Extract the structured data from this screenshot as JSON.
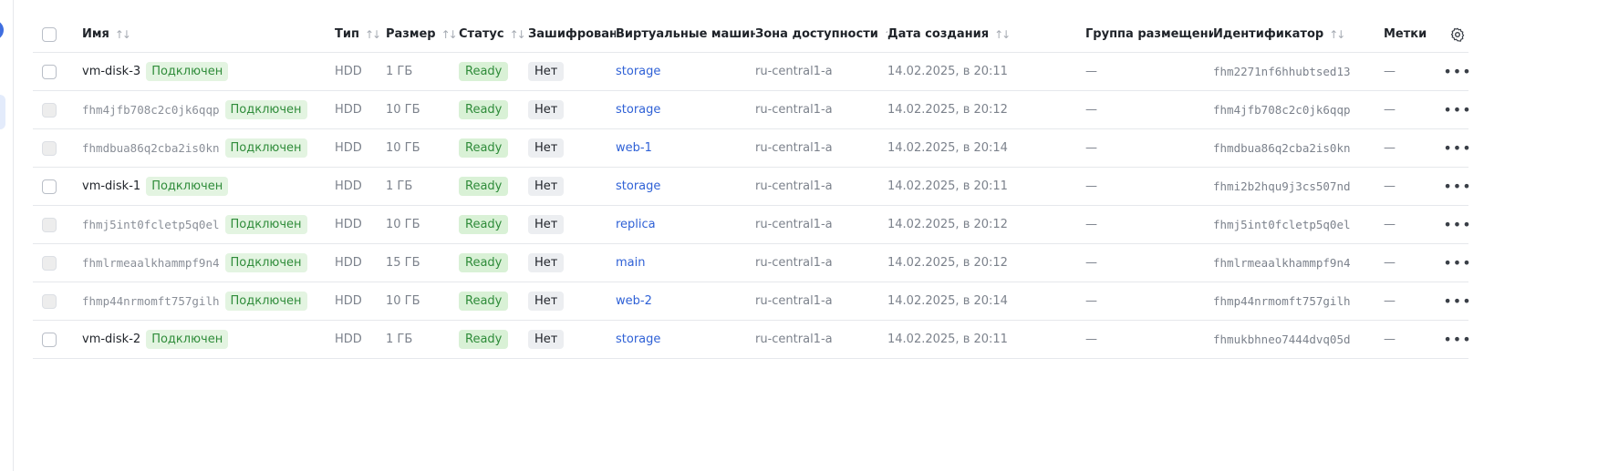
{
  "columns": {
    "name": "Имя",
    "type": "Тип",
    "size": "Размер",
    "status": "Статус",
    "encrypted": "Зашифрован",
    "vms": "Виртуальные машины",
    "zone": "Зона доступности",
    "created": "Дата создания",
    "group": "Группа размещения",
    "id": "Идентификатор",
    "labels": "Метки"
  },
  "icons": {
    "sort": "sort-arrows-icon",
    "settings": "gear-icon",
    "actions": "more-horizontal-icon"
  },
  "colors": {
    "accent": "#2f61d6",
    "ready_bg": "#d9f1d6",
    "ready_text": "#2f8c3a"
  },
  "rows": [
    {
      "name": "vm-disk-3",
      "attached": "Подключен",
      "type": "HDD",
      "size": "1 ГБ",
      "status": "Ready",
      "encrypted": "Нет",
      "vm": "storage",
      "zone": "ru-central1-a",
      "created": "14.02.2025, в 20:11",
      "group": "—",
      "id": "fhm2271nf6hhubtsed13",
      "labels": "—",
      "disabled": false
    },
    {
      "name": "fhm4jfb708c2c0jk6qqp",
      "attached": "Подключен",
      "type": "HDD",
      "size": "10 ГБ",
      "status": "Ready",
      "encrypted": "Нет",
      "vm": "storage",
      "zone": "ru-central1-a",
      "created": "14.02.2025, в 20:12",
      "group": "—",
      "id": "fhm4jfb708c2c0jk6qqp",
      "labels": "—",
      "disabled": true
    },
    {
      "name": "fhmdbua86q2cba2is0kn",
      "attached": "Подключен",
      "type": "HDD",
      "size": "10 ГБ",
      "status": "Ready",
      "encrypted": "Нет",
      "vm": "web-1",
      "zone": "ru-central1-a",
      "created": "14.02.2025, в 20:14",
      "group": "—",
      "id": "fhmdbua86q2cba2is0kn",
      "labels": "—",
      "disabled": true
    },
    {
      "name": "vm-disk-1",
      "attached": "Подключен",
      "type": "HDD",
      "size": "1 ГБ",
      "status": "Ready",
      "encrypted": "Нет",
      "vm": "storage",
      "zone": "ru-central1-a",
      "created": "14.02.2025, в 20:11",
      "group": "—",
      "id": "fhmi2b2hqu9j3cs507nd",
      "labels": "—",
      "disabled": false
    },
    {
      "name": "fhmj5int0fcletp5q0el",
      "attached": "Подключен",
      "type": "HDD",
      "size": "10 ГБ",
      "status": "Ready",
      "encrypted": "Нет",
      "vm": "replica",
      "zone": "ru-central1-a",
      "created": "14.02.2025, в 20:12",
      "group": "—",
      "id": "fhmj5int0fcletp5q0el",
      "labels": "—",
      "disabled": true
    },
    {
      "name": "fhmlrmeaalkhammpf9n4",
      "attached": "Подключен",
      "type": "HDD",
      "size": "15 ГБ",
      "status": "Ready",
      "encrypted": "Нет",
      "vm": "main",
      "zone": "ru-central1-a",
      "created": "14.02.2025, в 20:12",
      "group": "—",
      "id": "fhmlrmeaalkhammpf9n4",
      "labels": "—",
      "disabled": true
    },
    {
      "name": "fhmp44nrmomft757gilh",
      "attached": "Подключен",
      "type": "HDD",
      "size": "10 ГБ",
      "status": "Ready",
      "encrypted": "Нет",
      "vm": "web-2",
      "zone": "ru-central1-a",
      "created": "14.02.2025, в 20:14",
      "group": "—",
      "id": "fhmp44nrmomft757gilh",
      "labels": "—",
      "disabled": true
    },
    {
      "name": "vm-disk-2",
      "attached": "Подключен",
      "type": "HDD",
      "size": "1 ГБ",
      "status": "Ready",
      "encrypted": "Нет",
      "vm": "storage",
      "zone": "ru-central1-a",
      "created": "14.02.2025, в 20:11",
      "group": "—",
      "id": "fhmukbhneo7444dvq05d",
      "labels": "—",
      "disabled": false
    }
  ]
}
